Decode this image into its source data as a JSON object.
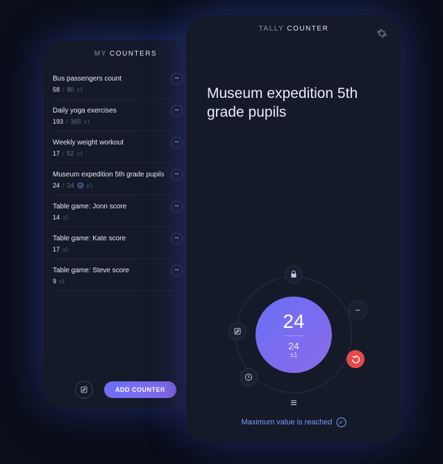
{
  "left_phone": {
    "header_title_prefix": "MY ",
    "header_title_accent": "COUNTERS",
    "counters": [
      {
        "title": "Bus passengers count",
        "count": "58",
        "target": "80",
        "step": "±1",
        "complete": false
      },
      {
        "title": "Daily yoga exercises",
        "count": "193",
        "target": "365",
        "step": "±1",
        "complete": false
      },
      {
        "title": "Weekly weight workout",
        "count": "17",
        "target": "52",
        "step": "±1",
        "complete": false
      },
      {
        "title": "Museum expedition 5th grade pupils",
        "count": "24",
        "target": "24",
        "step": "±1",
        "complete": true
      },
      {
        "title": "Table game: Jonn score",
        "count": "14",
        "target": "",
        "step": "±1",
        "complete": false
      },
      {
        "title": "Table game: Kate score",
        "count": "17",
        "target": "",
        "step": "±1",
        "complete": false
      },
      {
        "title": "Table game: Steve score",
        "count": "9",
        "target": "",
        "step": "±1",
        "complete": false
      }
    ],
    "add_button_label": "ADD COUNTER"
  },
  "right_phone": {
    "header_title_prefix": "TALLY ",
    "header_title_accent": "COUNTER",
    "counter_title": "Museum expedition 5th grade pupils",
    "dial_main": "24",
    "dial_sub": "24",
    "dial_step": "±1",
    "status_text": "Maximum value is reached"
  }
}
